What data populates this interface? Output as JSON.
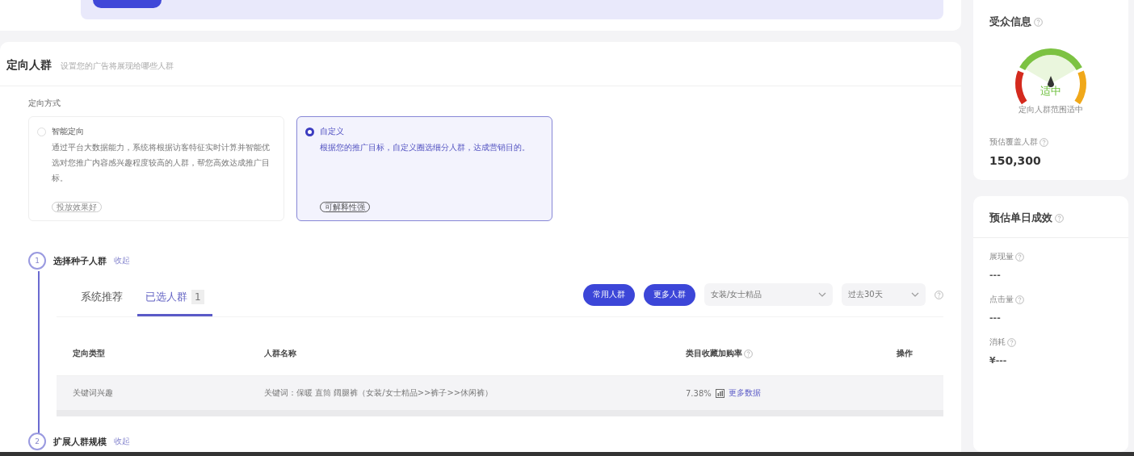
{
  "section": {
    "title": "定向人群",
    "subtitle": "设置您的广告将展现给哪些人群",
    "mode_label": "定向方式",
    "options": [
      {
        "title": "智能定向",
        "description": "通过平台大数据能力，系统将根据访客特征实时计算并智能优选对您推广内容感兴趣程度较高的人群，帮您高效达成推广目标。",
        "tag": "投放效果好",
        "selected": false
      },
      {
        "title": "自定义",
        "description": "根据您的推广目标，自定义圈选细分人群，达成营销目的。",
        "tag": "可解释性强",
        "selected": true
      }
    ],
    "steps": [
      {
        "number": "1",
        "title": "选择种子人群",
        "toggle": "收起"
      },
      {
        "number": "2",
        "title": "扩展人群规模",
        "toggle": "收起"
      }
    ],
    "tabs": [
      {
        "label": "系统推荐",
        "selected": false
      },
      {
        "label": "已选人群",
        "count": "1",
        "selected": true
      }
    ],
    "buttons": [
      "常用人群",
      "更多人群"
    ],
    "filters": [
      {
        "value": "女装/女士精品"
      },
      {
        "value": "过去30天"
      }
    ],
    "table": {
      "columns": [
        {
          "label": "定向类型",
          "help": false
        },
        {
          "label": "人群名称",
          "help": false
        },
        {
          "label": "类目收藏加购率",
          "help": true
        },
        {
          "label": "操作",
          "help": false
        }
      ],
      "rows": [
        {
          "type": "关键词兴趣",
          "name": "关键词：保暖 直筒 阔腿裤（女装/女士精品>>裤子>>休闲裤）",
          "rate": "7.38%",
          "link": "更多数据"
        }
      ]
    }
  },
  "sidebar": {
    "audience": {
      "title": "受众信息",
      "gauge": {
        "level": 0.5,
        "status": "适中",
        "caption": "定向人群范围适中"
      },
      "coverage_label": "预估覆盖人群",
      "coverage_value": "150,300"
    },
    "forecast": {
      "title": "预估单日成效",
      "metrics": [
        {
          "label": "展现量",
          "value": "---"
        },
        {
          "label": "点击量",
          "value": "---"
        },
        {
          "label": "消耗",
          "value": "¥---"
        }
      ]
    }
  }
}
